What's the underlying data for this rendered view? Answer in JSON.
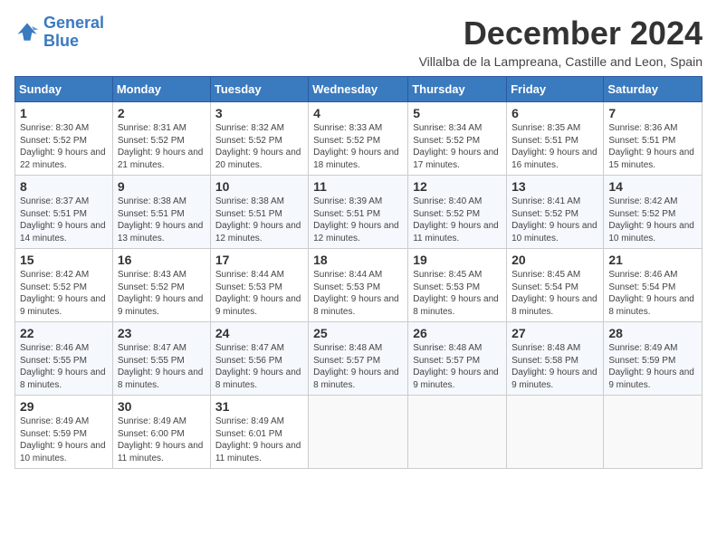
{
  "logo": {
    "line1": "General",
    "line2": "Blue"
  },
  "title": "December 2024",
  "subtitle": "Villalba de la Lampreana, Castille and Leon, Spain",
  "days_header": [
    "Sunday",
    "Monday",
    "Tuesday",
    "Wednesday",
    "Thursday",
    "Friday",
    "Saturday"
  ],
  "weeks": [
    [
      {
        "day": "1",
        "sunrise": "Sunrise: 8:30 AM",
        "sunset": "Sunset: 5:52 PM",
        "daylight": "Daylight: 9 hours and 22 minutes."
      },
      {
        "day": "2",
        "sunrise": "Sunrise: 8:31 AM",
        "sunset": "Sunset: 5:52 PM",
        "daylight": "Daylight: 9 hours and 21 minutes."
      },
      {
        "day": "3",
        "sunrise": "Sunrise: 8:32 AM",
        "sunset": "Sunset: 5:52 PM",
        "daylight": "Daylight: 9 hours and 20 minutes."
      },
      {
        "day": "4",
        "sunrise": "Sunrise: 8:33 AM",
        "sunset": "Sunset: 5:52 PM",
        "daylight": "Daylight: 9 hours and 18 minutes."
      },
      {
        "day": "5",
        "sunrise": "Sunrise: 8:34 AM",
        "sunset": "Sunset: 5:52 PM",
        "daylight": "Daylight: 9 hours and 17 minutes."
      },
      {
        "day": "6",
        "sunrise": "Sunrise: 8:35 AM",
        "sunset": "Sunset: 5:51 PM",
        "daylight": "Daylight: 9 hours and 16 minutes."
      },
      {
        "day": "7",
        "sunrise": "Sunrise: 8:36 AM",
        "sunset": "Sunset: 5:51 PM",
        "daylight": "Daylight: 9 hours and 15 minutes."
      }
    ],
    [
      {
        "day": "8",
        "sunrise": "Sunrise: 8:37 AM",
        "sunset": "Sunset: 5:51 PM",
        "daylight": "Daylight: 9 hours and 14 minutes."
      },
      {
        "day": "9",
        "sunrise": "Sunrise: 8:38 AM",
        "sunset": "Sunset: 5:51 PM",
        "daylight": "Daylight: 9 hours and 13 minutes."
      },
      {
        "day": "10",
        "sunrise": "Sunrise: 8:38 AM",
        "sunset": "Sunset: 5:51 PM",
        "daylight": "Daylight: 9 hours and 12 minutes."
      },
      {
        "day": "11",
        "sunrise": "Sunrise: 8:39 AM",
        "sunset": "Sunset: 5:51 PM",
        "daylight": "Daylight: 9 hours and 12 minutes."
      },
      {
        "day": "12",
        "sunrise": "Sunrise: 8:40 AM",
        "sunset": "Sunset: 5:52 PM",
        "daylight": "Daylight: 9 hours and 11 minutes."
      },
      {
        "day": "13",
        "sunrise": "Sunrise: 8:41 AM",
        "sunset": "Sunset: 5:52 PM",
        "daylight": "Daylight: 9 hours and 10 minutes."
      },
      {
        "day": "14",
        "sunrise": "Sunrise: 8:42 AM",
        "sunset": "Sunset: 5:52 PM",
        "daylight": "Daylight: 9 hours and 10 minutes."
      }
    ],
    [
      {
        "day": "15",
        "sunrise": "Sunrise: 8:42 AM",
        "sunset": "Sunset: 5:52 PM",
        "daylight": "Daylight: 9 hours and 9 minutes."
      },
      {
        "day": "16",
        "sunrise": "Sunrise: 8:43 AM",
        "sunset": "Sunset: 5:52 PM",
        "daylight": "Daylight: 9 hours and 9 minutes."
      },
      {
        "day": "17",
        "sunrise": "Sunrise: 8:44 AM",
        "sunset": "Sunset: 5:53 PM",
        "daylight": "Daylight: 9 hours and 9 minutes."
      },
      {
        "day": "18",
        "sunrise": "Sunrise: 8:44 AM",
        "sunset": "Sunset: 5:53 PM",
        "daylight": "Daylight: 9 hours and 8 minutes."
      },
      {
        "day": "19",
        "sunrise": "Sunrise: 8:45 AM",
        "sunset": "Sunset: 5:53 PM",
        "daylight": "Daylight: 9 hours and 8 minutes."
      },
      {
        "day": "20",
        "sunrise": "Sunrise: 8:45 AM",
        "sunset": "Sunset: 5:54 PM",
        "daylight": "Daylight: 9 hours and 8 minutes."
      },
      {
        "day": "21",
        "sunrise": "Sunrise: 8:46 AM",
        "sunset": "Sunset: 5:54 PM",
        "daylight": "Daylight: 9 hours and 8 minutes."
      }
    ],
    [
      {
        "day": "22",
        "sunrise": "Sunrise: 8:46 AM",
        "sunset": "Sunset: 5:55 PM",
        "daylight": "Daylight: 9 hours and 8 minutes."
      },
      {
        "day": "23",
        "sunrise": "Sunrise: 8:47 AM",
        "sunset": "Sunset: 5:55 PM",
        "daylight": "Daylight: 9 hours and 8 minutes."
      },
      {
        "day": "24",
        "sunrise": "Sunrise: 8:47 AM",
        "sunset": "Sunset: 5:56 PM",
        "daylight": "Daylight: 9 hours and 8 minutes."
      },
      {
        "day": "25",
        "sunrise": "Sunrise: 8:48 AM",
        "sunset": "Sunset: 5:57 PM",
        "daylight": "Daylight: 9 hours and 8 minutes."
      },
      {
        "day": "26",
        "sunrise": "Sunrise: 8:48 AM",
        "sunset": "Sunset: 5:57 PM",
        "daylight": "Daylight: 9 hours and 9 minutes."
      },
      {
        "day": "27",
        "sunrise": "Sunrise: 8:48 AM",
        "sunset": "Sunset: 5:58 PM",
        "daylight": "Daylight: 9 hours and 9 minutes."
      },
      {
        "day": "28",
        "sunrise": "Sunrise: 8:49 AM",
        "sunset": "Sunset: 5:59 PM",
        "daylight": "Daylight: 9 hours and 9 minutes."
      }
    ],
    [
      {
        "day": "29",
        "sunrise": "Sunrise: 8:49 AM",
        "sunset": "Sunset: 5:59 PM",
        "daylight": "Daylight: 9 hours and 10 minutes."
      },
      {
        "day": "30",
        "sunrise": "Sunrise: 8:49 AM",
        "sunset": "Sunset: 6:00 PM",
        "daylight": "Daylight: 9 hours and 11 minutes."
      },
      {
        "day": "31",
        "sunrise": "Sunrise: 8:49 AM",
        "sunset": "Sunset: 6:01 PM",
        "daylight": "Daylight: 9 hours and 11 minutes."
      },
      null,
      null,
      null,
      null
    ]
  ]
}
